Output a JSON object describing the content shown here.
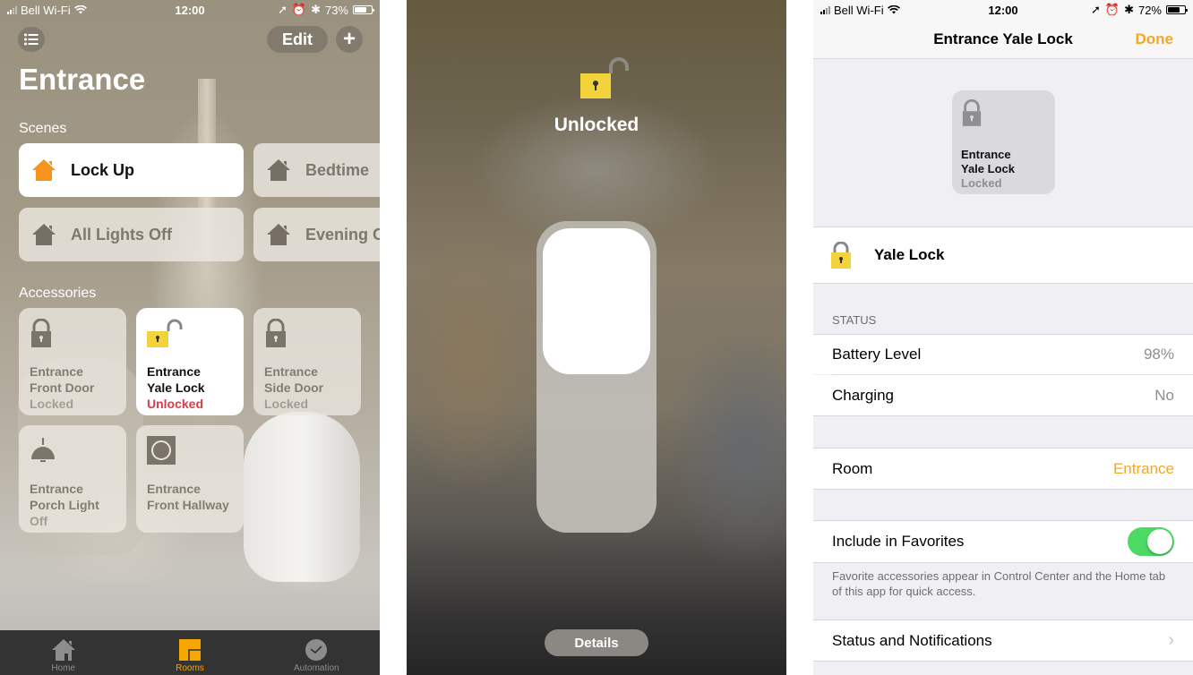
{
  "home_screen": {
    "status_bar": {
      "carrier": "Bell Wi-Fi",
      "time": "12:00",
      "battery": "73%",
      "battery_fraction": 0.73
    },
    "toolbar": {
      "edit_label": "Edit",
      "add_label": "+"
    },
    "room_title": "Entrance",
    "scenes_label": "Scenes",
    "scenes": [
      {
        "label": "Lock Up",
        "active": true
      },
      {
        "label": "Bedtime",
        "active": false
      },
      {
        "label": "All Lights Off",
        "active": false
      },
      {
        "label": "Evening C",
        "active": false
      }
    ],
    "accessories_label": "Accessories",
    "accessories": [
      {
        "room": "Entrance",
        "name": "Front Door",
        "status": "Locked",
        "icon": "lock-closed-icon",
        "active": false
      },
      {
        "room": "Entrance",
        "name": "Yale Lock",
        "status": "Unlocked",
        "icon": "lock-open-icon",
        "active": true
      },
      {
        "room": "Entrance",
        "name": "Side Door",
        "status": "Locked",
        "icon": "lock-closed-icon",
        "active": false
      },
      {
        "room": "Entrance",
        "name": "Porch Light",
        "status": "Off",
        "icon": "pendant-light-icon",
        "active": false
      },
      {
        "room": "Entrance",
        "name": "Front Hallway",
        "status": "",
        "icon": "sensor-icon",
        "active": false
      }
    ],
    "tabs": [
      {
        "label": "Home",
        "icon": "home-icon",
        "active": false
      },
      {
        "label": "Rooms",
        "icon": "rooms-icon",
        "active": true
      },
      {
        "label": "Automation",
        "icon": "clock-icon",
        "active": false
      }
    ],
    "colors": {
      "accent": "#f7a600",
      "unlocked": "#e0374a"
    }
  },
  "lock_control": {
    "state_label": "Unlocked",
    "details_label": "Details",
    "lock_yellow": "#f2d33c"
  },
  "details_screen": {
    "status_bar": {
      "carrier": "Bell Wi-Fi",
      "time": "12:00",
      "battery": "72%",
      "battery_fraction": 0.72
    },
    "nav_title": "Entrance Yale Lock",
    "done_label": "Done",
    "preview": {
      "room": "Entrance",
      "name": "Yale Lock",
      "status": "Locked"
    },
    "accessory_name": "Yale Lock",
    "status_header": "STATUS",
    "status_rows": [
      {
        "label": "Battery Level",
        "value": "98%"
      },
      {
        "label": "Charging",
        "value": "No"
      }
    ],
    "room_row": {
      "label": "Room",
      "value": "Entrance"
    },
    "favorites_row": {
      "label": "Include in Favorites",
      "enabled": true
    },
    "favorites_footnote": "Favorite accessories appear in Control Center and the Home tab of this app for quick access.",
    "notifications_row": {
      "label": "Status and Notifications"
    },
    "colors": {
      "accent": "#f5a623",
      "toggle_on": "#4cd964"
    }
  }
}
